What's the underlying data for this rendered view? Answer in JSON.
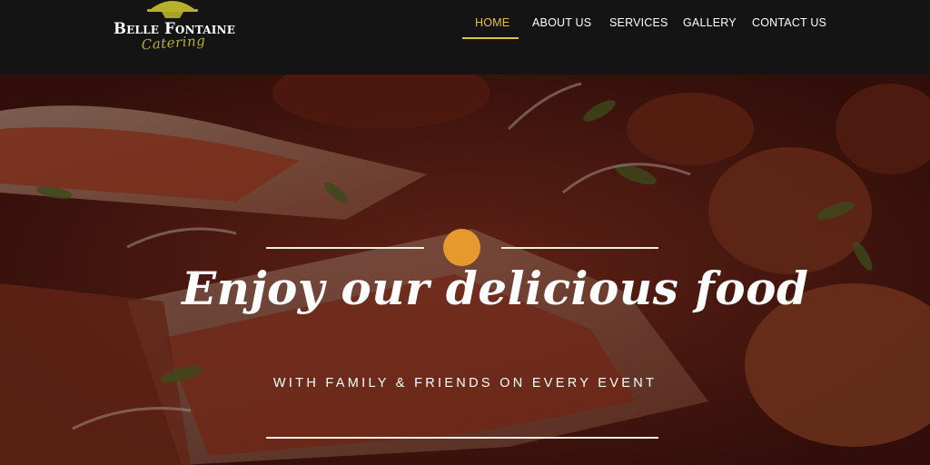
{
  "brand": {
    "name": "Belle Fontaine",
    "tagline": "Catering",
    "name_color": "#ffffff",
    "tagline_color": "#b7b12a"
  },
  "nav": {
    "items": [
      {
        "label": "HOME",
        "active": true
      },
      {
        "label": "ABOUT US",
        "active": false
      },
      {
        "label": "SERVICES",
        "active": false
      },
      {
        "label": "GALLERY",
        "active": false
      },
      {
        "label": "CONTACT US",
        "active": false
      }
    ],
    "active_color": "#e2c23b",
    "text_color": "#ffffff"
  },
  "hero": {
    "title": "Enjoy our delicious food",
    "subtitle": "WITH FAMILY & FRIENDS ON EVERY EVENT",
    "accent_dot_color": "#e69a2e",
    "background_image": "food-platter-photo"
  }
}
